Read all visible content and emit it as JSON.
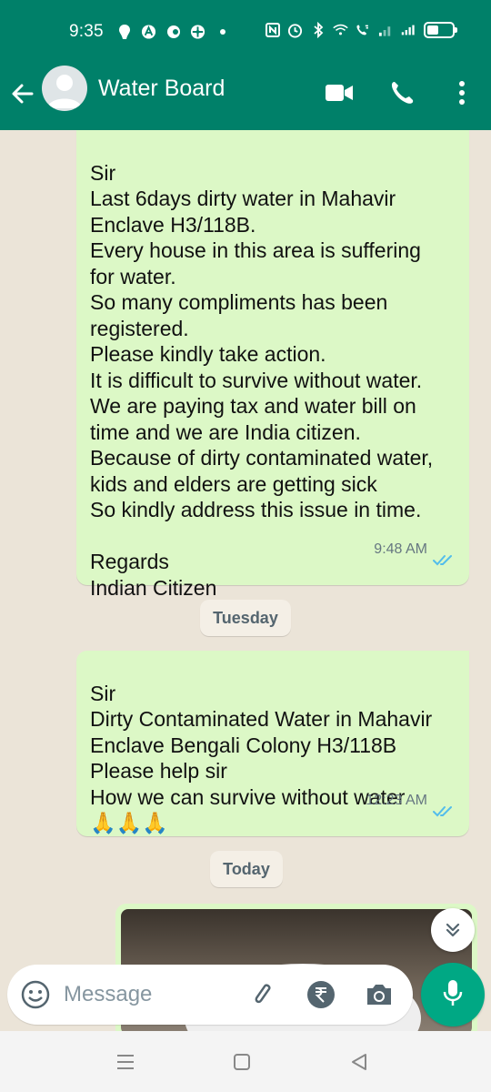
{
  "status_bar": {
    "time": "9:35"
  },
  "header": {
    "contact_name": "Water Board"
  },
  "messages": [
    {
      "text": "Sir\nLast 6days dirty water in Mahavir Enclave H3/118B.\nEvery house in this area is suffering for water.\nSo many compliments has been registered.\nPlease kindly take action.\nIt is difficult to survive without water.\nWe are paying tax and water bill on time and we are India citizen.\nBecause of dirty contaminated water, kids and elders are getting sick\nSo kindly address this issue in time.\n\nRegards\nIndian Citizen",
      "time": "9:48 AM",
      "status": "read"
    },
    {
      "text": "Sir\nDirty Contaminated Water in Mahavir Enclave Bengali Colony H3/118B\nPlease help sir\nHow we can survive without water\n🙏🙏🙏",
      "time": "12:23 AM",
      "status": "read"
    }
  ],
  "day_separators": {
    "first": "Tuesday",
    "second": "Today"
  },
  "composer": {
    "placeholder": "Message"
  },
  "colors": {
    "header": "#008069",
    "outgoing_bubble": "#dcf8c6",
    "read_ticks": "#53bdeb",
    "mic_button": "#00a884"
  },
  "icons": [
    "back-arrow-icon",
    "video-call-icon",
    "voice-call-icon",
    "more-options-icon",
    "emoji-icon",
    "attach-icon",
    "rupee-payment-icon",
    "camera-icon",
    "mic-icon",
    "scroll-down-icon"
  ]
}
